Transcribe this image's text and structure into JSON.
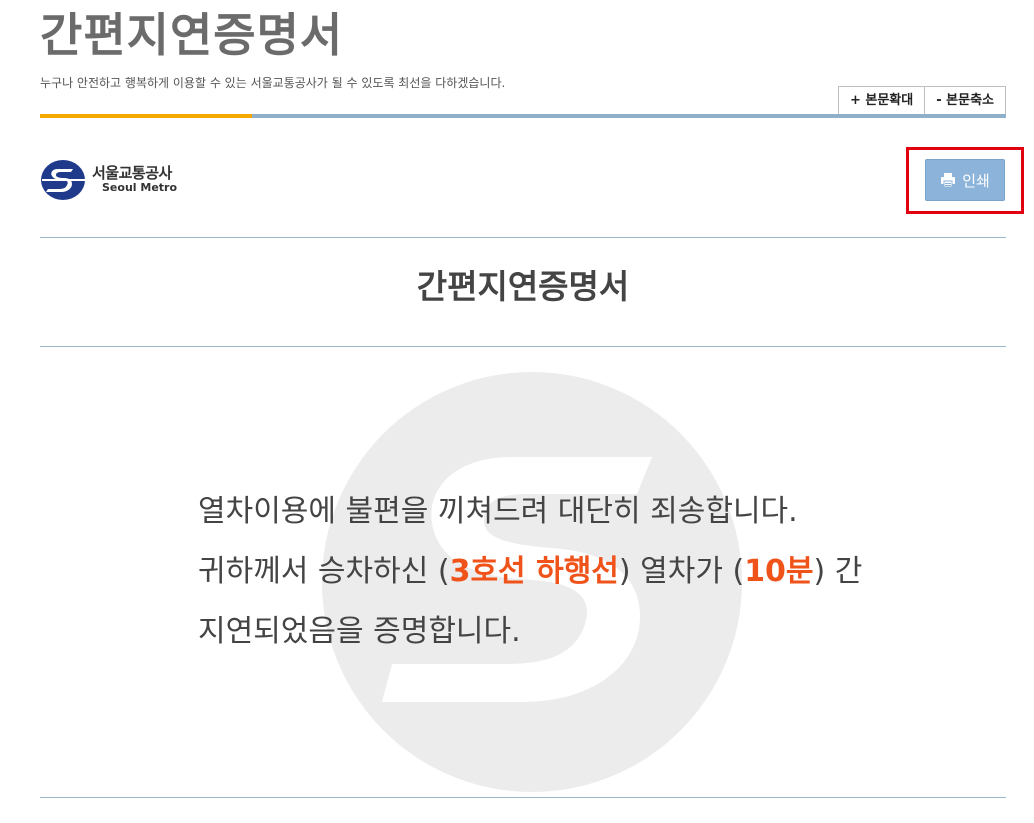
{
  "header": {
    "title": "간편지연증명서",
    "subtitle": "누구나 안전하고 행복하게 이용할 수 있는 서울교통공사가 될 수 있도록 최선을 다하겠습니다.",
    "zoom_in_label": "+ 본문확대",
    "zoom_out_label": "- 본문축소"
  },
  "logo": {
    "name_ko": "서울교통공사",
    "name_en": "Seoul Metro"
  },
  "print_button": {
    "label": "인쇄",
    "icon": "printer-icon"
  },
  "certificate": {
    "title": "간편지연증명서",
    "line1": "열차이용에 불편을 끼쳐드려 대단히 죄송합니다.",
    "line2_prefix": "귀하께서 승차하신 (",
    "line_name": "3호선 하행선",
    "line2_middle": ") 열차가 (",
    "delay": "10분",
    "line2_suffix": ") 간",
    "line3": "지연되었음을 증명합니다."
  },
  "colors": {
    "title_gray": "#6b6b6b",
    "accent_orange": "#f5a800",
    "bar_blue": "#8fb0c8",
    "highlight_red": "#f0531a",
    "print_button_blue": "#8cb3d9",
    "annotation_red": "#e0000f",
    "logo_navy": "#1f3a8a"
  }
}
